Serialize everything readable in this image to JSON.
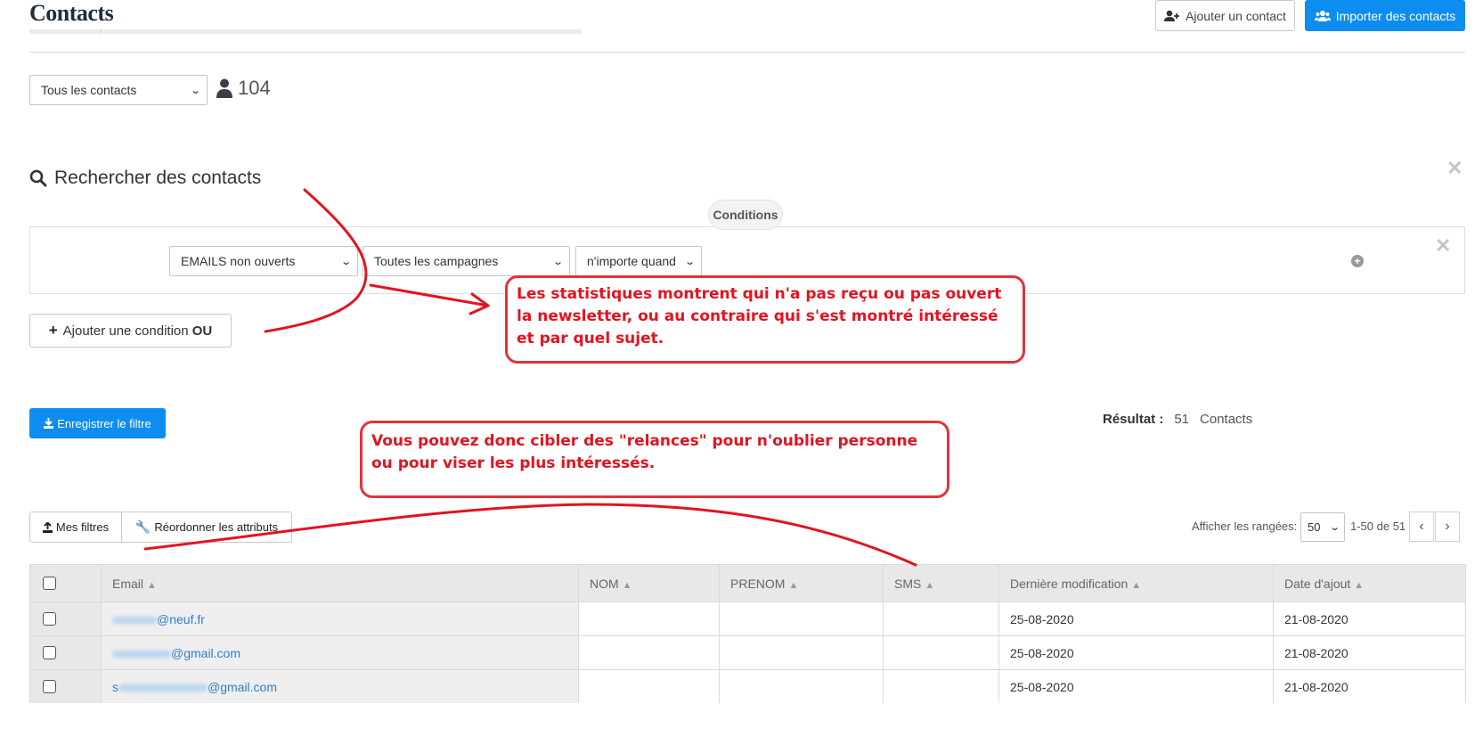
{
  "header": {
    "title": "Contacts",
    "add_contact_label": "Ajouter un contact",
    "import_contacts_label": "Importer des contacts"
  },
  "list_select": {
    "value": "Tous les contacts"
  },
  "contacts_count": "104",
  "search": {
    "title": "Rechercher des contacts",
    "conditions_label": "Conditions",
    "condition": {
      "type": "EMAILS non ouverts",
      "campaign": "Toutes les campagnes",
      "when": "n'importe quand"
    },
    "add_or_condition_prefix": "Ajouter une condition ",
    "add_or_condition_bold": "OU"
  },
  "save_filter_label": "Enregistrer le filtre",
  "result": {
    "label": "Résultat :",
    "count": "51",
    "unit": "Contacts"
  },
  "annotations": {
    "box1": "Les statistiques montrent qui n'a pas reçu ou pas ouvert la newsletter, ou au contraire qui s'est montré intéressé et par quel sujet.",
    "box2": "Vous pouvez donc cibler des \"relances\" pour n'oublier personne ou pour viser les plus intéressés."
  },
  "toolbar": {
    "my_filters_label": "Mes filtres",
    "reorder_label": "Réordonner les attributs",
    "rows_label": "Afficher les rangées:",
    "rows_value": "50",
    "range_text": "1-50 de 51"
  },
  "table": {
    "columns": [
      "Email",
      "NOM",
      "PRENOM",
      "SMS",
      "Dernière modification",
      "Date d'ajout"
    ],
    "rows": [
      {
        "email_suffix": "@neuf.fr",
        "nom": "",
        "prenom": "",
        "sms": "",
        "modified": "25-08-2020",
        "added": "21-08-2020"
      },
      {
        "email_suffix": "@gmail.com",
        "nom": "",
        "prenom": "",
        "sms": "",
        "modified": "25-08-2020",
        "added": "21-08-2020"
      },
      {
        "email_prefix": "s",
        "email_suffix": "@gmail.com",
        "nom": "",
        "prenom": "",
        "sms": "",
        "modified": "25-08-2020",
        "added": "21-08-2020"
      }
    ]
  },
  "colors": {
    "primary": "#0d8df0",
    "annotation": "#e3131f",
    "link": "#2b7fd1"
  }
}
